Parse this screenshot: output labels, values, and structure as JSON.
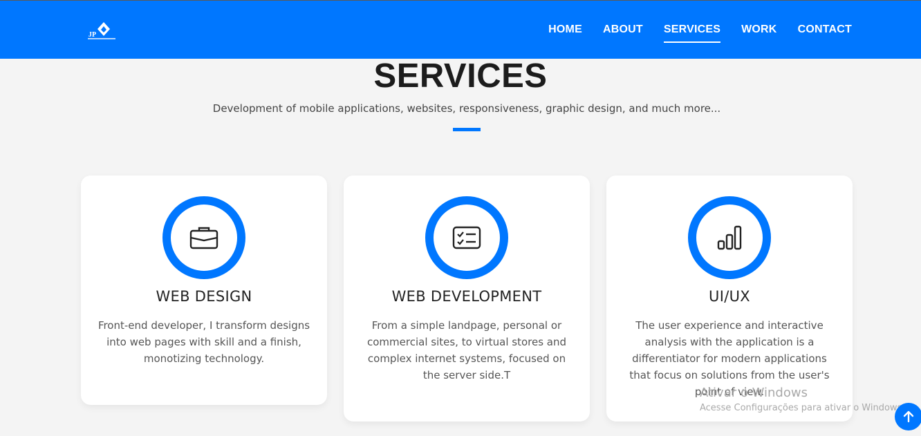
{
  "nav": {
    "logo_text": "JP",
    "links": [
      {
        "label": "HOME",
        "active": false
      },
      {
        "label": "ABOUT",
        "active": false
      },
      {
        "label": "SERVICES",
        "active": true
      },
      {
        "label": "WORK",
        "active": false
      },
      {
        "label": "CONTACT",
        "active": false
      }
    ]
  },
  "services": {
    "title": "SERVICES",
    "subtitle": "Development of mobile applications, websites, responsiveness, graphic design, and much more...",
    "cards": [
      {
        "icon": "briefcase-icon",
        "title": "WEB DESIGN",
        "text": "Front-end developer, I transform designs into web pages with skill and a finish, monotizing technology."
      },
      {
        "icon": "checklist-icon",
        "title": "WEB DEVELOPMENT",
        "text": "From a simple landpage, personal or commercial sites, to virtual stores and complex internet systems, focused on the server side.T"
      },
      {
        "icon": "bar-chart-icon",
        "title": "UI/UX",
        "text": "The user experience and interactive analysis with the application is a differentiator for modern applications that focus on solutions from the user's point of view."
      }
    ]
  },
  "watermark": {
    "line1": "Ativar o Windows",
    "line2": "Acesse Configurações para ativar o Windows."
  },
  "scroll_top": {
    "icon": "arrow-up-icon"
  },
  "colors": {
    "accent": "#0077ff",
    "background": "#f4f4f4",
    "card": "#ffffff"
  }
}
